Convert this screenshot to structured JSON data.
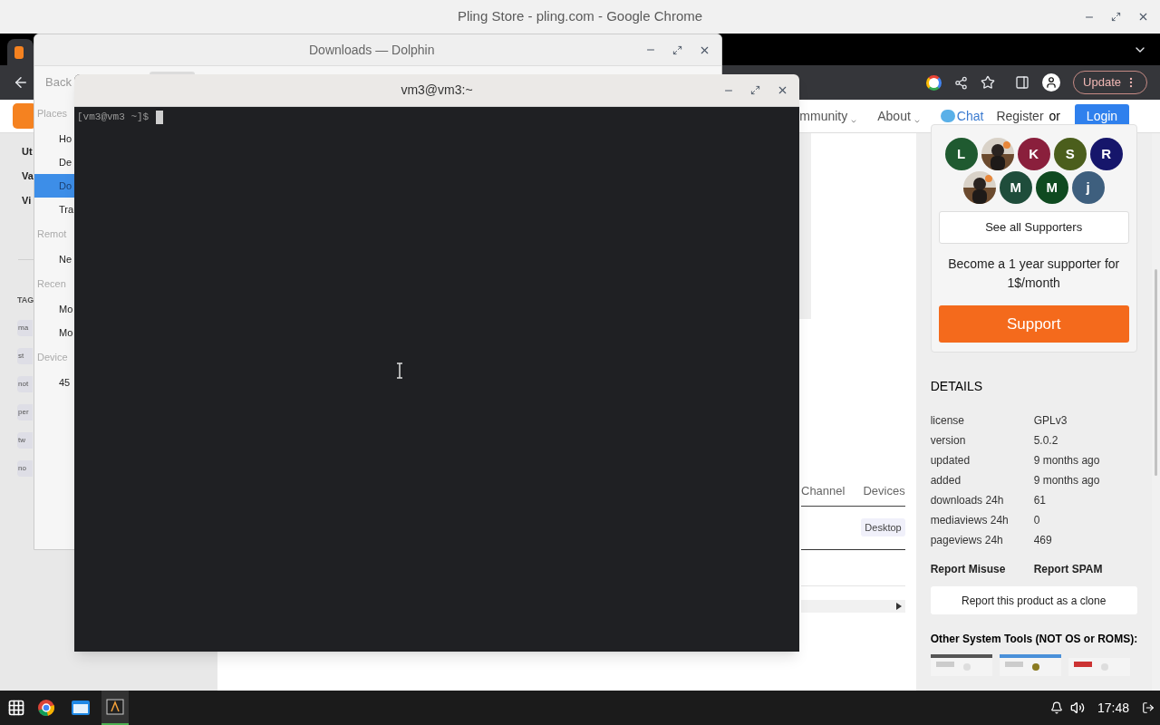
{
  "chrome": {
    "title": "Pling Store - pling.com - Google Chrome",
    "update_button": "Update"
  },
  "site": {
    "nav": [
      "mmunity",
      "About"
    ],
    "chat": "Chat",
    "register": "Register",
    "or": "or",
    "login": "Login",
    "left": {
      "items": [
        "Ut",
        "Va",
        "Vi"
      ],
      "tags_heading": "TAG",
      "tags": [
        "ma",
        "st",
        "not",
        "per",
        "tw",
        "no"
      ]
    },
    "content": {
      "tabs": [
        "Channel",
        "Devices"
      ],
      "chip": "Desktop"
    },
    "supporters": [
      {
        "letter": "L",
        "color": "#1f5a30"
      },
      {
        "kind": "picture"
      },
      {
        "letter": "K",
        "color": "#8a1f3c"
      },
      {
        "letter": "S",
        "color": "#4b5e1c"
      },
      {
        "letter": "R",
        "color": "#16166b"
      },
      {
        "kind": "picture"
      },
      {
        "letter": "M",
        "color": "#1f4d3b"
      },
      {
        "letter": "M",
        "color": "#0f4a20"
      },
      {
        "letter": "j",
        "color": "#3e5f7e"
      }
    ],
    "see_all": "See all Supporters",
    "become": "Become a 1 year supporter for 1$/month",
    "support": "Support",
    "details_heading": "DETAILS",
    "details": [
      {
        "label": "license",
        "value": "GPLv3"
      },
      {
        "label": "version",
        "value": "5.0.2"
      },
      {
        "label": "updated",
        "value": "9 months ago"
      },
      {
        "label": "added",
        "value": "9 months ago"
      },
      {
        "label": "downloads 24h",
        "value": "61"
      },
      {
        "label": "mediaviews 24h",
        "value": "0"
      },
      {
        "label": "pageviews 24h",
        "value": "469"
      }
    ],
    "report_misuse": "Report Misuse",
    "report_spam": "Report SPAM",
    "report_clone": "Report this product as a clone",
    "other_heading": "Other System Tools (NOT OS or ROMS):"
  },
  "dolphin": {
    "title": "Downloads — Dolphin",
    "back": "Back",
    "sections": [
      {
        "heading": "Places",
        "items": [
          {
            "label": "Ho",
            "selected": false
          },
          {
            "label": "De",
            "selected": false
          },
          {
            "label": "Do",
            "selected": true
          },
          {
            "label": "Tra",
            "selected": false
          }
        ]
      },
      {
        "heading": "Remot",
        "items": [
          {
            "label": "Ne",
            "selected": false
          }
        ]
      },
      {
        "heading": "Recen",
        "items": [
          {
            "label": "Mo",
            "selected": false
          },
          {
            "label": "Mo",
            "selected": false
          }
        ]
      },
      {
        "heading": "Device",
        "items": [
          {
            "label": "45",
            "selected": false
          }
        ]
      }
    ]
  },
  "terminal": {
    "title": "vm3@vm3:~",
    "prompt": "[vm3@vm3 ~]$"
  },
  "taskbar": {
    "apps": [
      {
        "kind": "chrome",
        "selected": false
      },
      {
        "kind": "files",
        "selected": false
      },
      {
        "kind": "terminal",
        "selected": true
      }
    ],
    "time": "17:48"
  }
}
